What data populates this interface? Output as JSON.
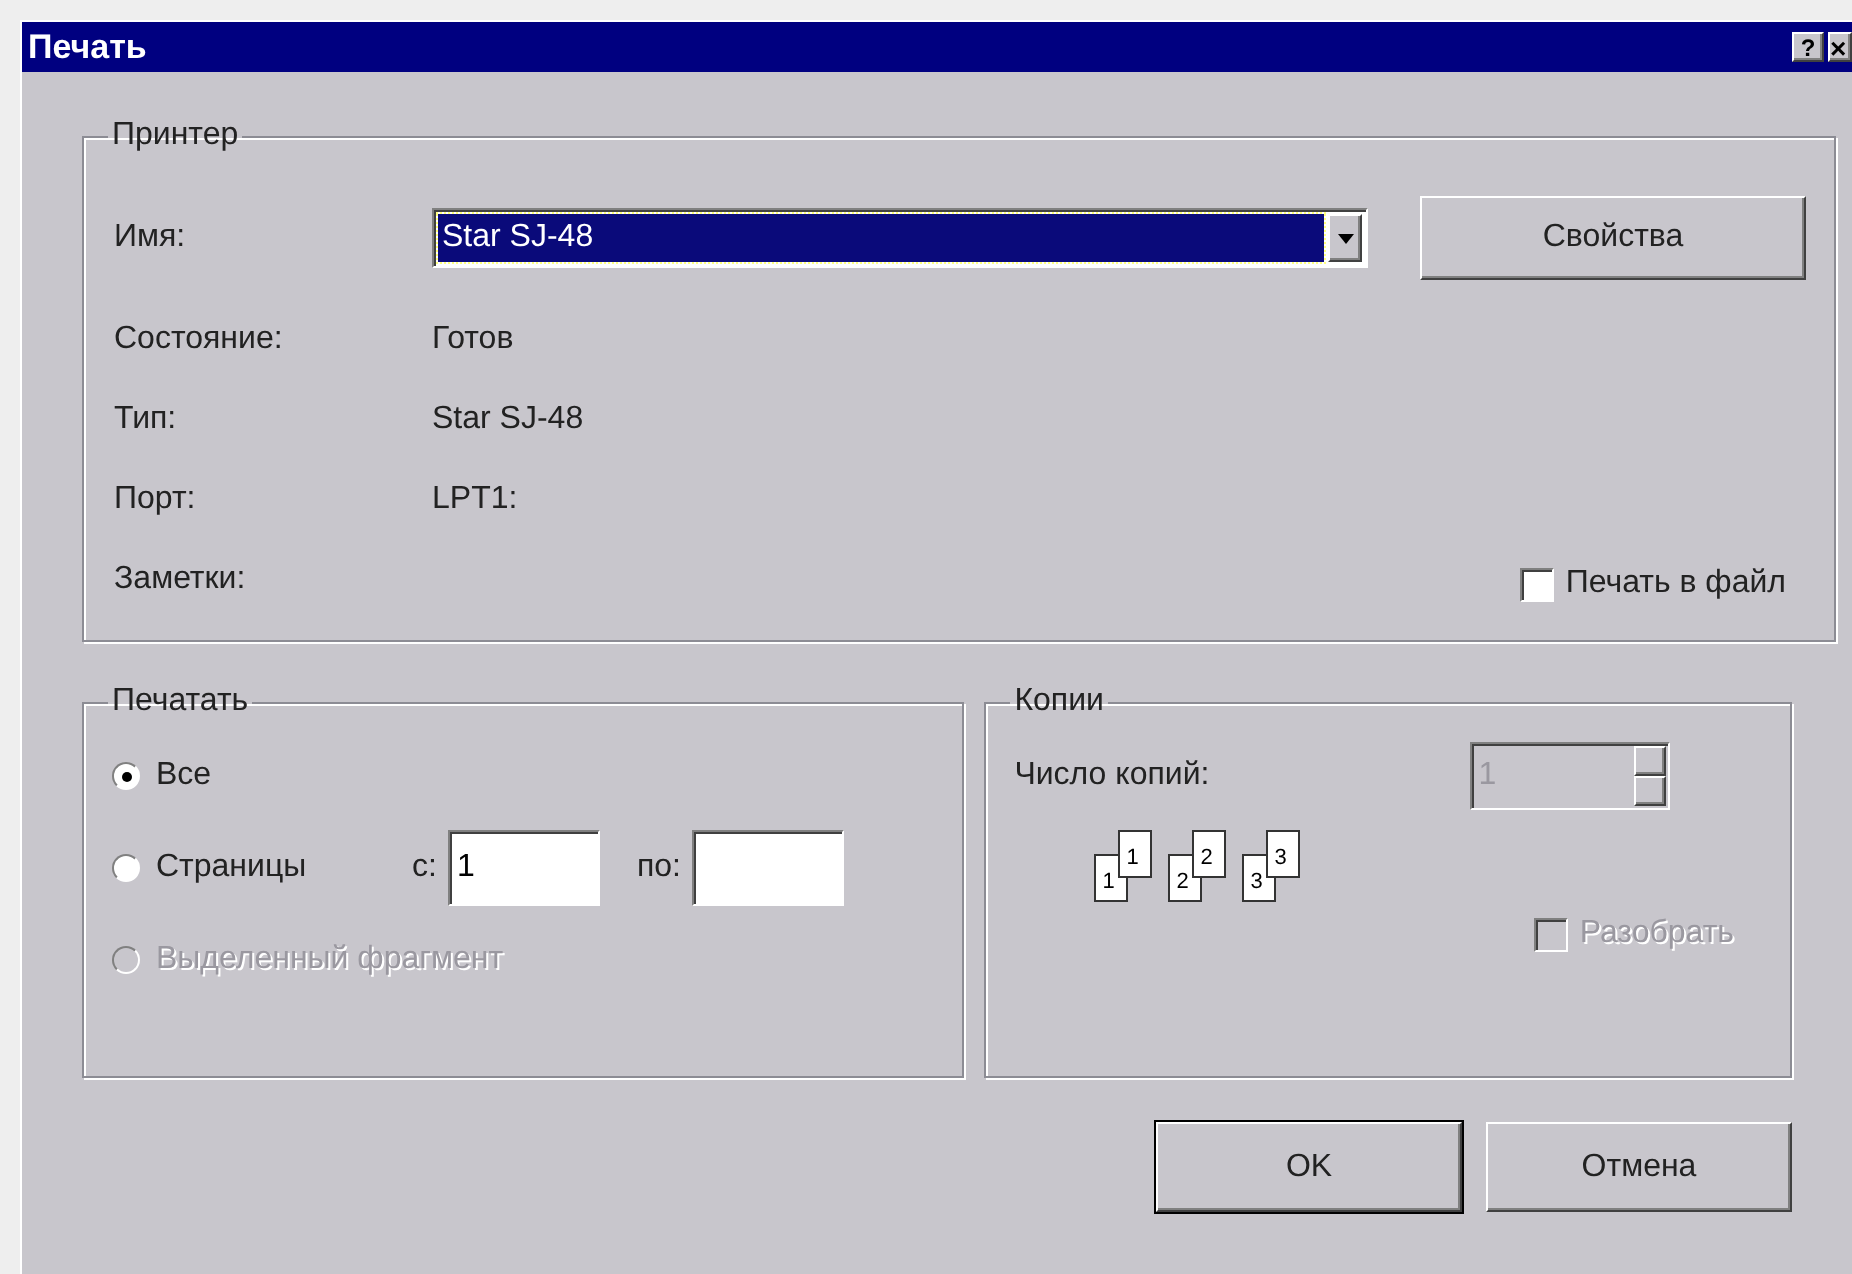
{
  "window": {
    "title": "Печать",
    "help": "?",
    "close": "×"
  },
  "printer": {
    "title": "Принтер",
    "name_label": "Имя:",
    "name_value": "Star SJ-48",
    "properties_button": "Свойства",
    "info": [
      {
        "label": "Состояние:",
        "value": "Готов"
      },
      {
        "label": "Тип:",
        "value": "Star SJ-48"
      },
      {
        "label": "Порт:",
        "value": "LPT1:"
      },
      {
        "label": "Заметки:"
      }
    ],
    "print_to_file": {
      "label": "Печать в файл",
      "checked": false
    }
  },
  "print_range": {
    "title": "Печатать",
    "options": [
      {
        "label": "Все",
        "selected": true,
        "disabled": false
      },
      {
        "label": "Страницы",
        "selected": false,
        "disabled": false,
        "range": {
          "from_label": "с:",
          "from_value": "1",
          "to_label": "по:"
        }
      },
      {
        "label": "Выделенный фрагмент",
        "selected": false,
        "disabled": true
      }
    ]
  },
  "copies": {
    "title": "Копии",
    "count_label": "Число копий:",
    "count_value": "1",
    "count_disabled": true,
    "collate_pages": [
      [
        "1",
        "1"
      ],
      [
        "2",
        "2"
      ],
      [
        "3",
        "3"
      ]
    ],
    "collate": {
      "label": "Разобрать",
      "checked": false,
      "disabled": true
    }
  },
  "buttons": [
    {
      "label": "OK",
      "default": true
    },
    {
      "label": "Отмена",
      "default": false
    }
  ]
}
